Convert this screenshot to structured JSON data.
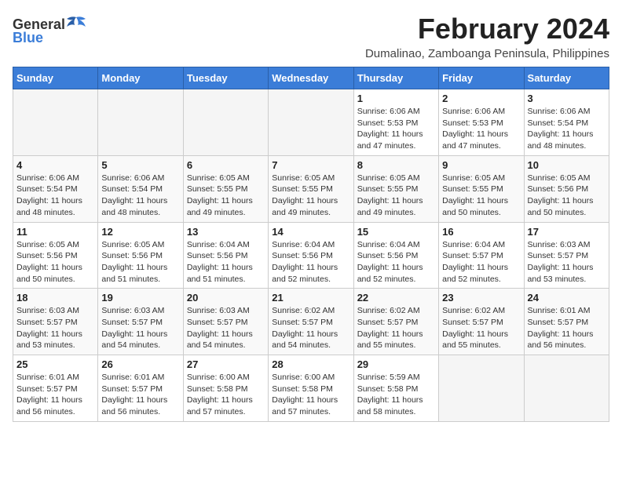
{
  "logo": {
    "general": "General",
    "blue": "Blue"
  },
  "title": "February 2024",
  "subtitle": "Dumalinao, Zamboanga Peninsula, Philippines",
  "days_of_week": [
    "Sunday",
    "Monday",
    "Tuesday",
    "Wednesday",
    "Thursday",
    "Friday",
    "Saturday"
  ],
  "weeks": [
    [
      {
        "day": "",
        "details": ""
      },
      {
        "day": "",
        "details": ""
      },
      {
        "day": "",
        "details": ""
      },
      {
        "day": "",
        "details": ""
      },
      {
        "day": "1",
        "details": "Sunrise: 6:06 AM\nSunset: 5:53 PM\nDaylight: 11 hours and 47 minutes."
      },
      {
        "day": "2",
        "details": "Sunrise: 6:06 AM\nSunset: 5:53 PM\nDaylight: 11 hours and 47 minutes."
      },
      {
        "day": "3",
        "details": "Sunrise: 6:06 AM\nSunset: 5:54 PM\nDaylight: 11 hours and 48 minutes."
      }
    ],
    [
      {
        "day": "4",
        "details": "Sunrise: 6:06 AM\nSunset: 5:54 PM\nDaylight: 11 hours and 48 minutes."
      },
      {
        "day": "5",
        "details": "Sunrise: 6:06 AM\nSunset: 5:54 PM\nDaylight: 11 hours and 48 minutes."
      },
      {
        "day": "6",
        "details": "Sunrise: 6:05 AM\nSunset: 5:55 PM\nDaylight: 11 hours and 49 minutes."
      },
      {
        "day": "7",
        "details": "Sunrise: 6:05 AM\nSunset: 5:55 PM\nDaylight: 11 hours and 49 minutes."
      },
      {
        "day": "8",
        "details": "Sunrise: 6:05 AM\nSunset: 5:55 PM\nDaylight: 11 hours and 49 minutes."
      },
      {
        "day": "9",
        "details": "Sunrise: 6:05 AM\nSunset: 5:55 PM\nDaylight: 11 hours and 50 minutes."
      },
      {
        "day": "10",
        "details": "Sunrise: 6:05 AM\nSunset: 5:56 PM\nDaylight: 11 hours and 50 minutes."
      }
    ],
    [
      {
        "day": "11",
        "details": "Sunrise: 6:05 AM\nSunset: 5:56 PM\nDaylight: 11 hours and 50 minutes."
      },
      {
        "day": "12",
        "details": "Sunrise: 6:05 AM\nSunset: 5:56 PM\nDaylight: 11 hours and 51 minutes."
      },
      {
        "day": "13",
        "details": "Sunrise: 6:04 AM\nSunset: 5:56 PM\nDaylight: 11 hours and 51 minutes."
      },
      {
        "day": "14",
        "details": "Sunrise: 6:04 AM\nSunset: 5:56 PM\nDaylight: 11 hours and 52 minutes."
      },
      {
        "day": "15",
        "details": "Sunrise: 6:04 AM\nSunset: 5:56 PM\nDaylight: 11 hours and 52 minutes."
      },
      {
        "day": "16",
        "details": "Sunrise: 6:04 AM\nSunset: 5:57 PM\nDaylight: 11 hours and 52 minutes."
      },
      {
        "day": "17",
        "details": "Sunrise: 6:03 AM\nSunset: 5:57 PM\nDaylight: 11 hours and 53 minutes."
      }
    ],
    [
      {
        "day": "18",
        "details": "Sunrise: 6:03 AM\nSunset: 5:57 PM\nDaylight: 11 hours and 53 minutes."
      },
      {
        "day": "19",
        "details": "Sunrise: 6:03 AM\nSunset: 5:57 PM\nDaylight: 11 hours and 54 minutes."
      },
      {
        "day": "20",
        "details": "Sunrise: 6:03 AM\nSunset: 5:57 PM\nDaylight: 11 hours and 54 minutes."
      },
      {
        "day": "21",
        "details": "Sunrise: 6:02 AM\nSunset: 5:57 PM\nDaylight: 11 hours and 54 minutes."
      },
      {
        "day": "22",
        "details": "Sunrise: 6:02 AM\nSunset: 5:57 PM\nDaylight: 11 hours and 55 minutes."
      },
      {
        "day": "23",
        "details": "Sunrise: 6:02 AM\nSunset: 5:57 PM\nDaylight: 11 hours and 55 minutes."
      },
      {
        "day": "24",
        "details": "Sunrise: 6:01 AM\nSunset: 5:57 PM\nDaylight: 11 hours and 56 minutes."
      }
    ],
    [
      {
        "day": "25",
        "details": "Sunrise: 6:01 AM\nSunset: 5:57 PM\nDaylight: 11 hours and 56 minutes."
      },
      {
        "day": "26",
        "details": "Sunrise: 6:01 AM\nSunset: 5:57 PM\nDaylight: 11 hours and 56 minutes."
      },
      {
        "day": "27",
        "details": "Sunrise: 6:00 AM\nSunset: 5:58 PM\nDaylight: 11 hours and 57 minutes."
      },
      {
        "day": "28",
        "details": "Sunrise: 6:00 AM\nSunset: 5:58 PM\nDaylight: 11 hours and 57 minutes."
      },
      {
        "day": "29",
        "details": "Sunrise: 5:59 AM\nSunset: 5:58 PM\nDaylight: 11 hours and 58 minutes."
      },
      {
        "day": "",
        "details": ""
      },
      {
        "day": "",
        "details": ""
      }
    ]
  ]
}
